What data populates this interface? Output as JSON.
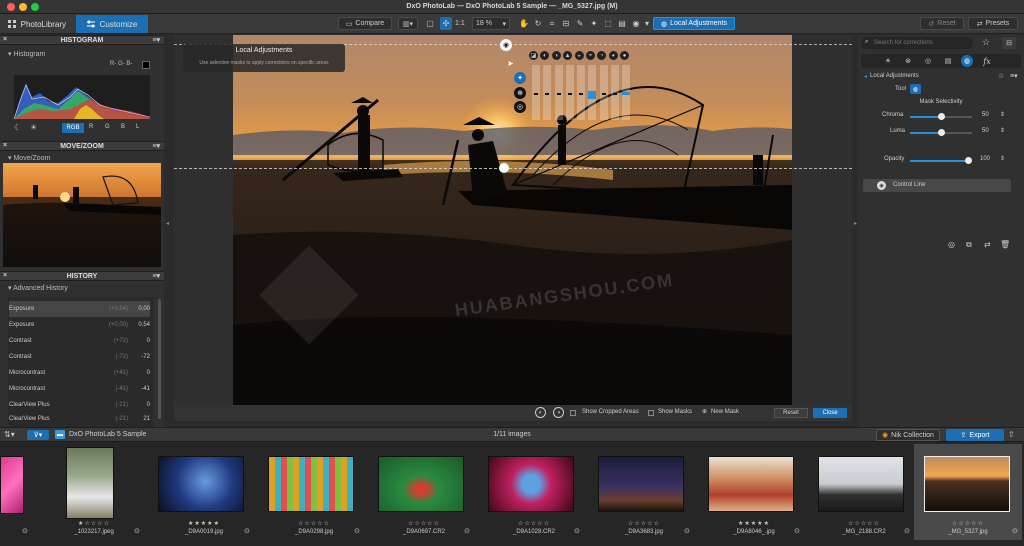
{
  "window": {
    "title": "DxO PhotoLab — DxO PhotoLab 5 Sample — _MG_5327.jpg (M)"
  },
  "tabs": [
    {
      "label": "PhotoLibrary"
    },
    {
      "label": "Customize"
    }
  ],
  "toolbar": {
    "compare": "Compare",
    "ratio": "1:1",
    "zoom": "18 %",
    "local_adjustments": "Local Adjustments",
    "reset": "Reset",
    "presets": "Presets"
  },
  "histogram": {
    "header": "HISTOGRAM",
    "title": "Histogram",
    "readout": "R- G- B-",
    "channels": [
      "RGB",
      "R",
      "G",
      "B",
      "L"
    ]
  },
  "movezoom": {
    "header": "MOVE/ZOOM",
    "title": "Move/Zoom"
  },
  "history": {
    "header": "HISTORY",
    "title": "Advanced History",
    "rows": [
      {
        "name": "Exposure",
        "old": "(+0,54)",
        "val": "0,00"
      },
      {
        "name": "Exposure",
        "old": "(+0,00)",
        "val": "0,54"
      },
      {
        "name": "Contrast",
        "old": "(+72)",
        "val": "0"
      },
      {
        "name": "Contrast",
        "old": "(-72)",
        "val": "-72"
      },
      {
        "name": "Microcontrast",
        "old": "(+41)",
        "val": "0"
      },
      {
        "name": "Microcontrast",
        "old": "(-41)",
        "val": "-41"
      },
      {
        "name": "ClearView Plus",
        "old": "(-21)",
        "val": "0"
      },
      {
        "name": "ClearView Plus",
        "old": "(-21)",
        "val": "21"
      }
    ]
  },
  "local_tip": {
    "title": "Local Adjustments",
    "text": "Use selective masks to apply corrections on specific areas"
  },
  "bottom": {
    "show_cropped": "Show Cropped Areas",
    "show_masks": "Show Masks",
    "new_mask": "New Mask",
    "reset": "Reset",
    "close": "Close"
  },
  "right": {
    "search_placeholder": "Search for corrections",
    "section": "Local Adjustments",
    "tool": "Tool",
    "mask_selectivity": "Mask Selectivity",
    "chroma_label": "Chroma",
    "chroma_val": "50",
    "chroma": 0.5,
    "luma_label": "Luma",
    "luma_val": "50",
    "luma": 0.5,
    "opacity_label": "Opacity",
    "opacity_val": "100",
    "opacity": 1.0,
    "control_line": "Control Line",
    "fx": "fx"
  },
  "filmstrip": {
    "folder": "DxO PhotoLab 5 Sample",
    "count": "1/11 images",
    "nik": "Nik Collection",
    "export": "Export",
    "items": [
      {
        "name": "_1023217.jpeg",
        "stars": "★☆☆☆☆"
      },
      {
        "name": "_D9A0019.jpg",
        "stars": "★★★★★"
      },
      {
        "name": "_D9A0298.jpg",
        "stars": "☆☆☆☆☆"
      },
      {
        "name": "_D9A0697.CR2",
        "stars": "☆☆☆☆☆"
      },
      {
        "name": "_D9A1028.CR2",
        "stars": "☆☆☆☆☆"
      },
      {
        "name": "_D9A3683.jpg",
        "stars": "☆☆☆☆☆"
      },
      {
        "name": "_D9A8046_.jpg",
        "stars": "★★★★★"
      },
      {
        "name": "_MG_2188.CR2",
        "stars": "☆☆☆☆☆"
      },
      {
        "name": "_MG_5327.jpg",
        "stars": "☆☆☆☆☆"
      }
    ]
  },
  "watermark": {
    "text": "HUABANGSHOU.COM"
  },
  "colors": {
    "accent": "#1c8ce0",
    "panel": "#303030",
    "header": "#3c3c3c"
  }
}
